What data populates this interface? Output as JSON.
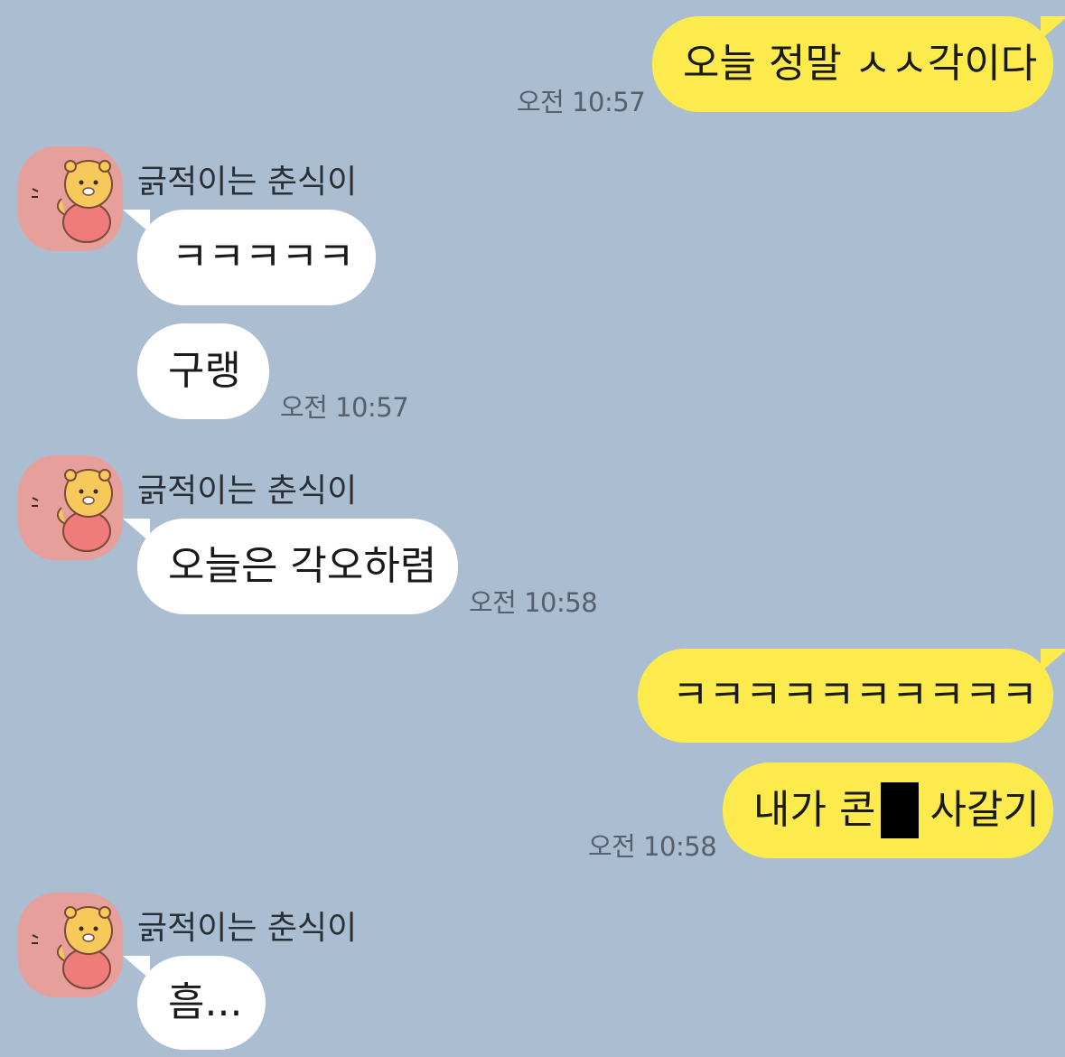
{
  "chat": {
    "messages": [
      {
        "text": "오늘 정말 ㅅㅅ각이다",
        "time": "오전 10:57"
      },
      {
        "sender": "긁적이는 춘식이",
        "text": "ㅋㅋㅋㅋㅋ"
      },
      {
        "text": "구랭",
        "time": "오전 10:57"
      },
      {
        "sender": "긁적이는 춘식이",
        "text": "오늘은 각오하렴",
        "time": "오전 10:58"
      },
      {
        "text": "ㅋㅋㅋㅋㅋㅋㅋㅋㅋㅋ"
      },
      {
        "text_before": "내가 콘",
        "text_after": "사갈기",
        "time": "오전 10:58"
      },
      {
        "sender": "긁적이는 춘식이",
        "text": "흠..."
      }
    ]
  },
  "colors": {
    "background": "#abbdd1",
    "outgoing_bubble": "#fdeb4e",
    "incoming_bubble": "#ffffff",
    "avatar_bg": "#e79f9b"
  },
  "icons": {
    "avatar": "chunsik-character-icon"
  }
}
